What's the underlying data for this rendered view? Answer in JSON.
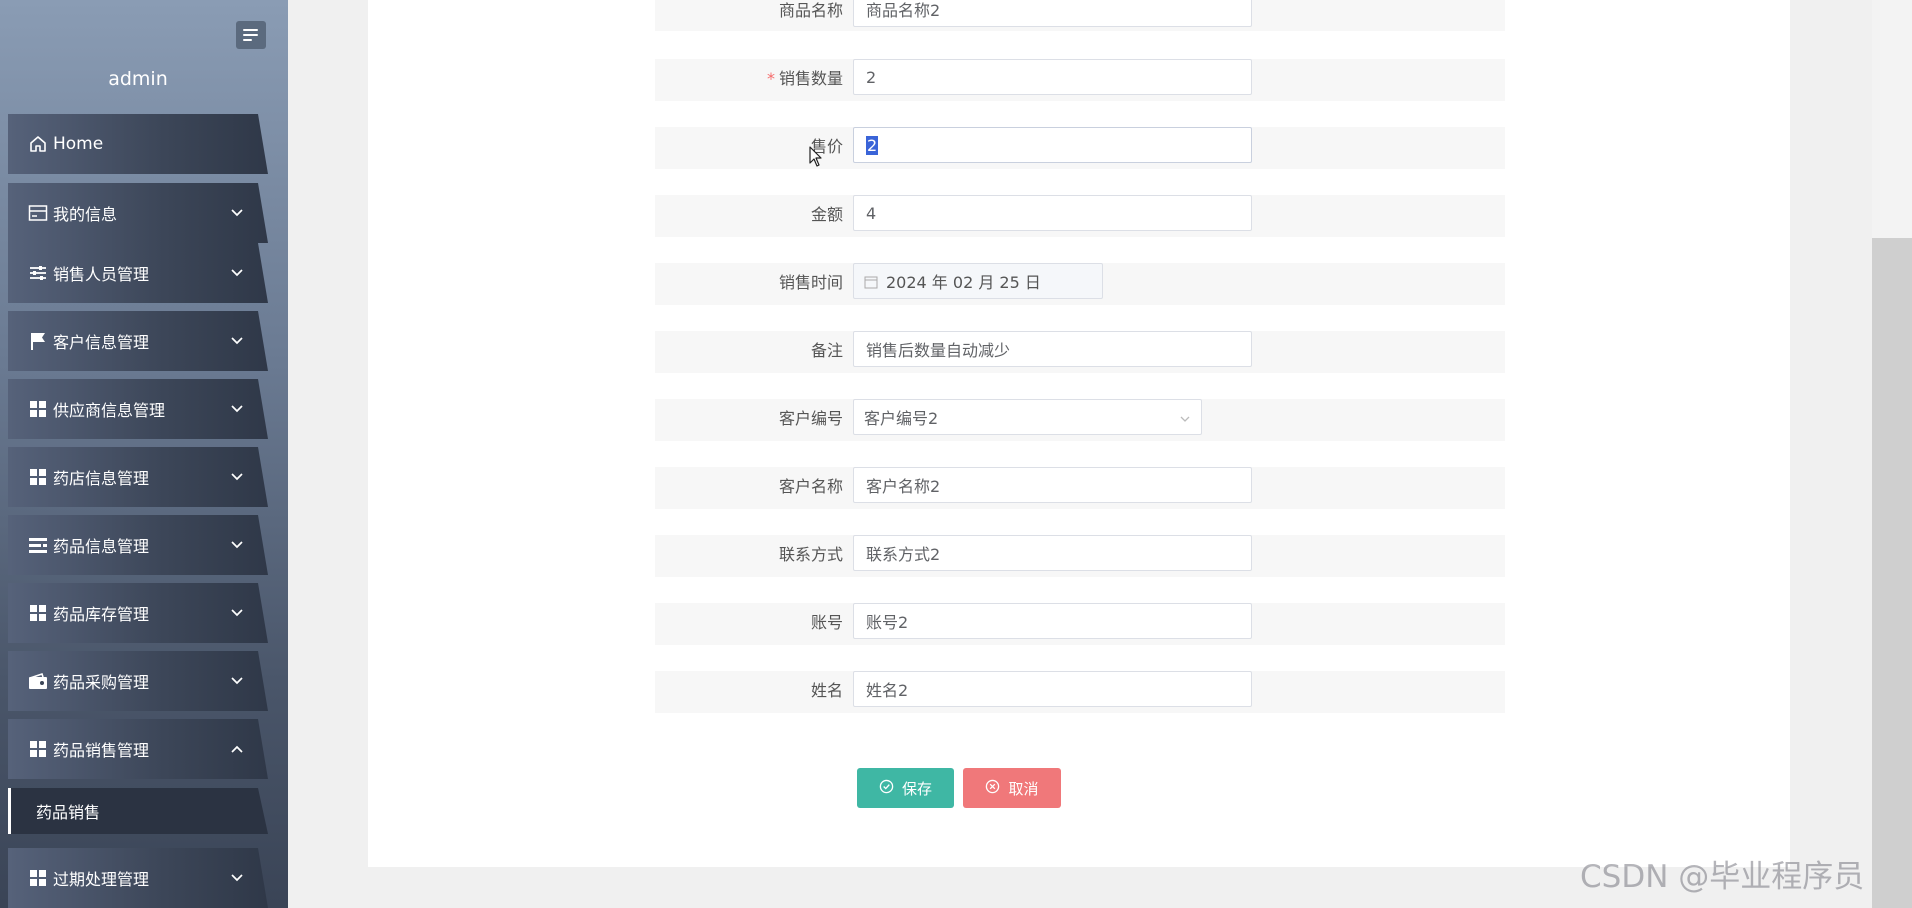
{
  "sidebar": {
    "username": "admin",
    "menu": [
      {
        "label": "Home",
        "icon": "home-icon"
      },
      {
        "label": "我的信息",
        "icon": "card-icon"
      },
      {
        "label": "销售人员管理",
        "icon": "sliders-icon"
      },
      {
        "label": "客户信息管理",
        "icon": "flag-icon"
      },
      {
        "label": "供应商信息管理",
        "icon": "grid-icon"
      },
      {
        "label": "药店信息管理",
        "icon": "grid-icon"
      },
      {
        "label": "药品信息管理",
        "icon": "list-icon"
      },
      {
        "label": "药品库存管理",
        "icon": "grid-icon"
      },
      {
        "label": "药品采购管理",
        "icon": "wallet-icon"
      },
      {
        "label": "药品销售管理",
        "icon": "grid-icon",
        "expanded": true
      },
      {
        "label": "过期处理管理",
        "icon": "grid-icon"
      }
    ],
    "submenu_active": "药品销售"
  },
  "form": {
    "fields": [
      {
        "label": "商品名称",
        "value": "商品名称2"
      },
      {
        "label": "销售数量",
        "value": "2",
        "required": true
      },
      {
        "label": "售价",
        "value": "2"
      },
      {
        "label": "金额",
        "value": "4"
      },
      {
        "label": "销售时间",
        "value": "2024 年 02 月 25 日"
      },
      {
        "label": "备注",
        "value": "销售后数量自动减少"
      },
      {
        "label": "客户编号",
        "value": "客户编号2"
      },
      {
        "label": "客户名称",
        "value": "客户名称2"
      },
      {
        "label": "联系方式",
        "value": "联系方式2"
      },
      {
        "label": "账号",
        "value": "账号2"
      },
      {
        "label": "姓名",
        "value": "姓名2"
      }
    ],
    "required_mark": "*",
    "save_label": "保存",
    "cancel_label": "取消"
  },
  "watermark": "CSDN @毕业程序员",
  "colors": {
    "save": "#3fb7a4",
    "cancel": "#f0787a",
    "required": "#f56c6c"
  }
}
